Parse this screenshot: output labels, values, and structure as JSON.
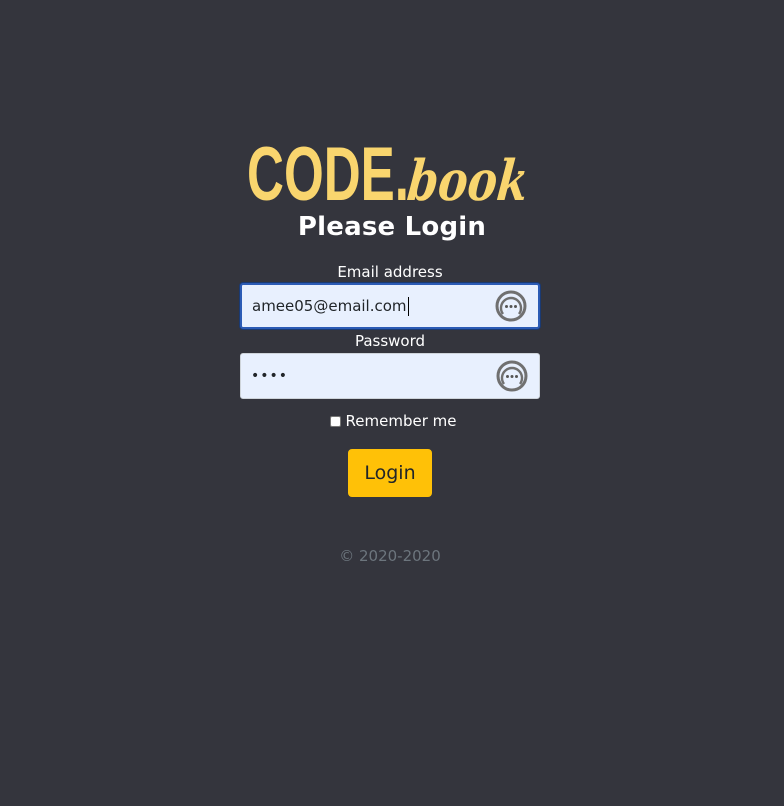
{
  "logo": {
    "code_text": "CODE.",
    "book_text": "book",
    "color": "#f9d56e"
  },
  "heading": "Please Login",
  "email": {
    "label": "Email address",
    "value": "amee05@email.com"
  },
  "password": {
    "label": "Password",
    "masked_value": "••••"
  },
  "field_icon": "password-manager-key-icon",
  "remember": {
    "label": "Remember me",
    "checked": false
  },
  "login_button": "Login",
  "footer": {
    "copyright": "© 2020-2020"
  },
  "colors": {
    "background": "#34353d",
    "accent": "#ffc107",
    "input_fill": "#e8f0fe",
    "focus_border": "#2b5bb5",
    "muted_text": "#6c757d"
  }
}
